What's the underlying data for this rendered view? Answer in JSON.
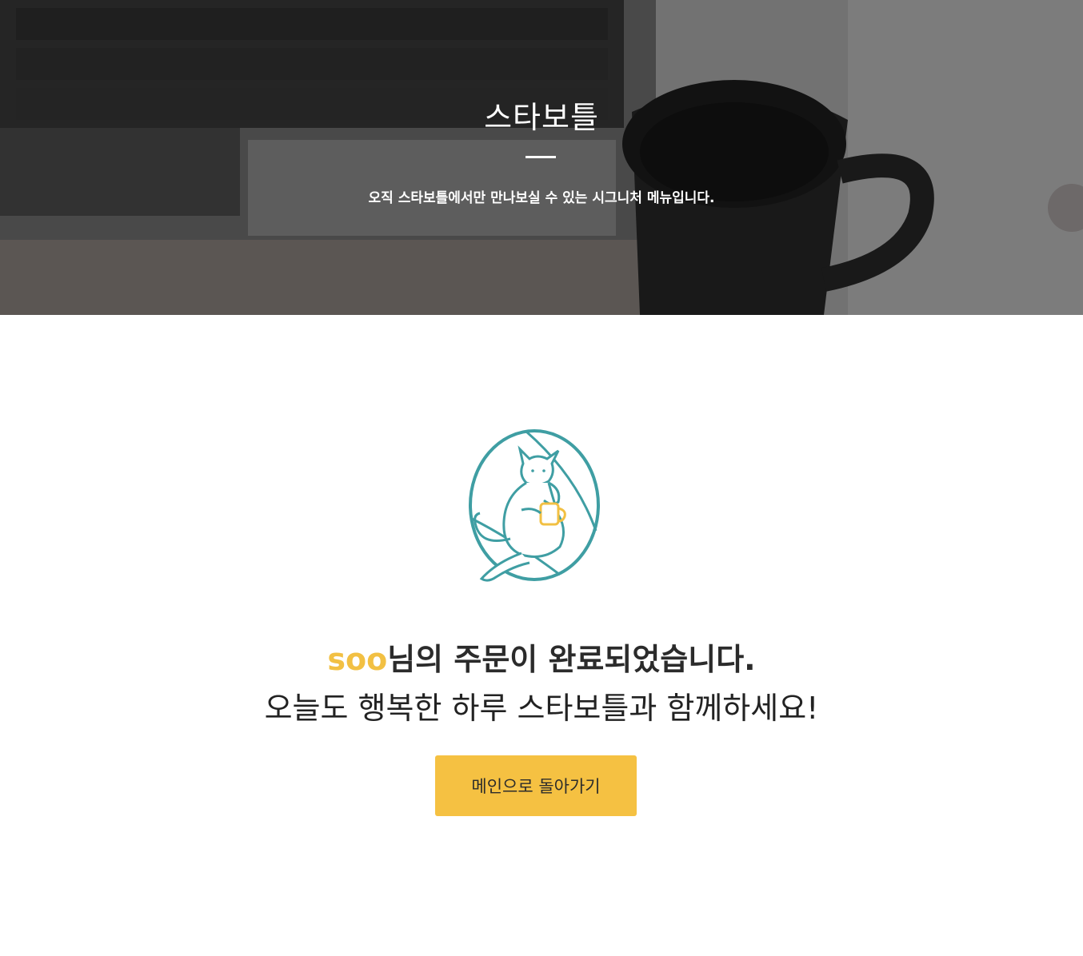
{
  "hero": {
    "title": "스타보틀",
    "subtitle": "오직 스타보틀에서만 만나보실 수 있는 시그니처 메뉴입니다."
  },
  "order": {
    "user_name": "soo",
    "complete_text": "님의 주문이 완료되었습니다.",
    "greeting": "오늘도 행복한 하루 스타보틀과 함께하세요!",
    "home_button_label": "메인으로 돌아가기"
  },
  "colors": {
    "accent": "#f5c142",
    "user_name": "#f2c043",
    "logo_teal": "#3f9ea3"
  }
}
